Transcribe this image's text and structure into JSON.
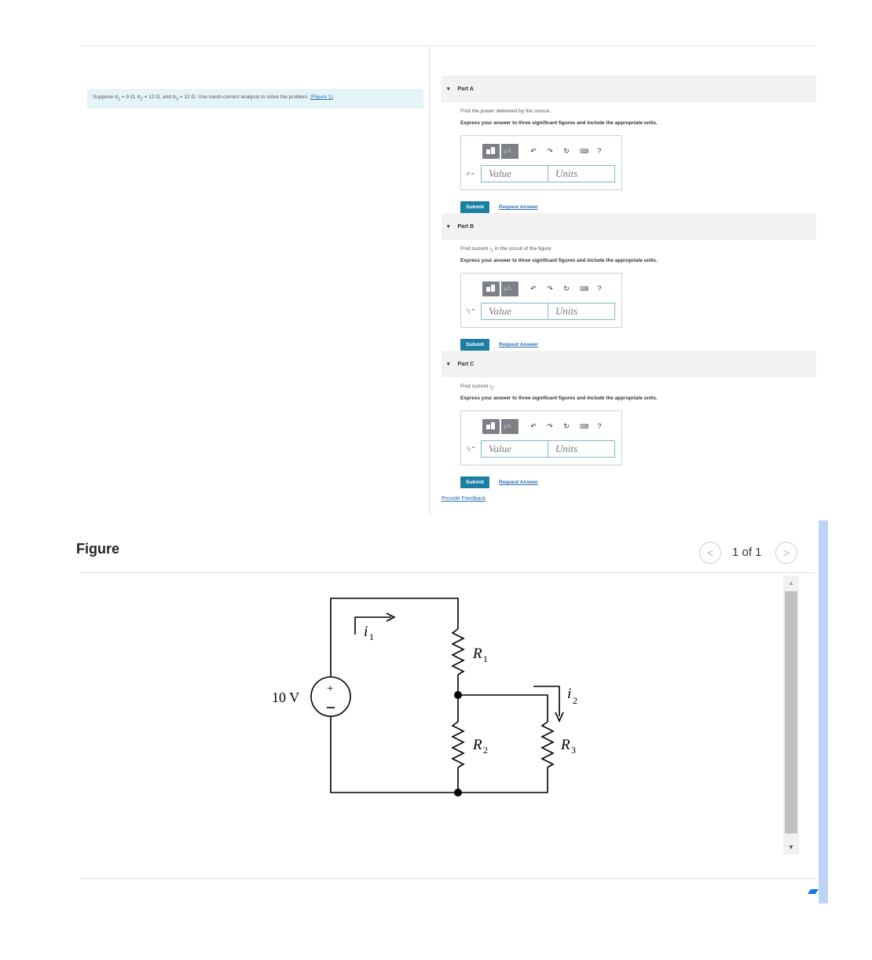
{
  "problem": {
    "text_prefix": "Suppose ",
    "r1_sym": "R",
    "r1_sub": "1",
    "r1_val": " = 9 Ω, ",
    "r2_sym": "R",
    "r2_sub": "2",
    "r2_val": " = 12 Ω, and ",
    "r3_sym": "R",
    "r3_sub": "3",
    "r3_val": " = 12 Ω. Use mesh-current analysis to solve the problem. ",
    "figure_link": "(Figure 1)"
  },
  "parts": [
    {
      "header": "Part A",
      "question_prefix": "Find the power delivered by the source.",
      "question_var": "",
      "question_suffix": "",
      "instruction": "Express your answer to three significant figures and include the appropriate units.",
      "var_label": "P",
      "var_sub": "",
      "eq": " =",
      "value_placeholder": "Value",
      "units_placeholder": "Units",
      "submit_label": "Submit",
      "request_label": "Request Answer"
    },
    {
      "header": "Part B",
      "question_prefix": "Find current ",
      "question_var": "i",
      "question_sub": "1",
      "question_suffix": " in the circuit of the figure",
      "instruction": "Express your answer to three significant figures and include the appropriate units.",
      "var_label": "i",
      "var_sub": "1",
      "eq": " =",
      "value_placeholder": "Value",
      "units_placeholder": "Units",
      "submit_label": "Submit",
      "request_label": "Request Answer"
    },
    {
      "header": "Part C",
      "question_prefix": "Find current ",
      "question_var": "i",
      "question_sub": "2",
      "question_suffix": ".",
      "instruction": "Express your answer to three significant figures and include the appropriate units.",
      "var_label": "i",
      "var_sub": "2",
      "eq": " =",
      "value_placeholder": "Value",
      "units_placeholder": "Units",
      "submit_label": "Submit",
      "request_label": "Request Answer"
    }
  ],
  "toolbar": {
    "mu_label": "μA",
    "help_label": "?",
    "icons": [
      "templates-icon",
      "mu-units-icon",
      "undo-icon",
      "redo-icon",
      "reset-icon",
      "keyboard-icon",
      "help-icon"
    ]
  },
  "feedback_label": "Provide Feedback",
  "figure_panel": {
    "title": "Figure",
    "page_count": "1 of 1",
    "prev_glyph": "<",
    "next_glyph": ">"
  },
  "circuit": {
    "source_label": "10 V",
    "plus": "+",
    "minus": "−",
    "i1": "i",
    "i1_sub": "1",
    "i2": "i",
    "i2_sub": "2",
    "r1": "R",
    "r1_sub": "1",
    "r2": "R",
    "r2_sub": "2",
    "r3": "R",
    "r3_sub": "3"
  }
}
